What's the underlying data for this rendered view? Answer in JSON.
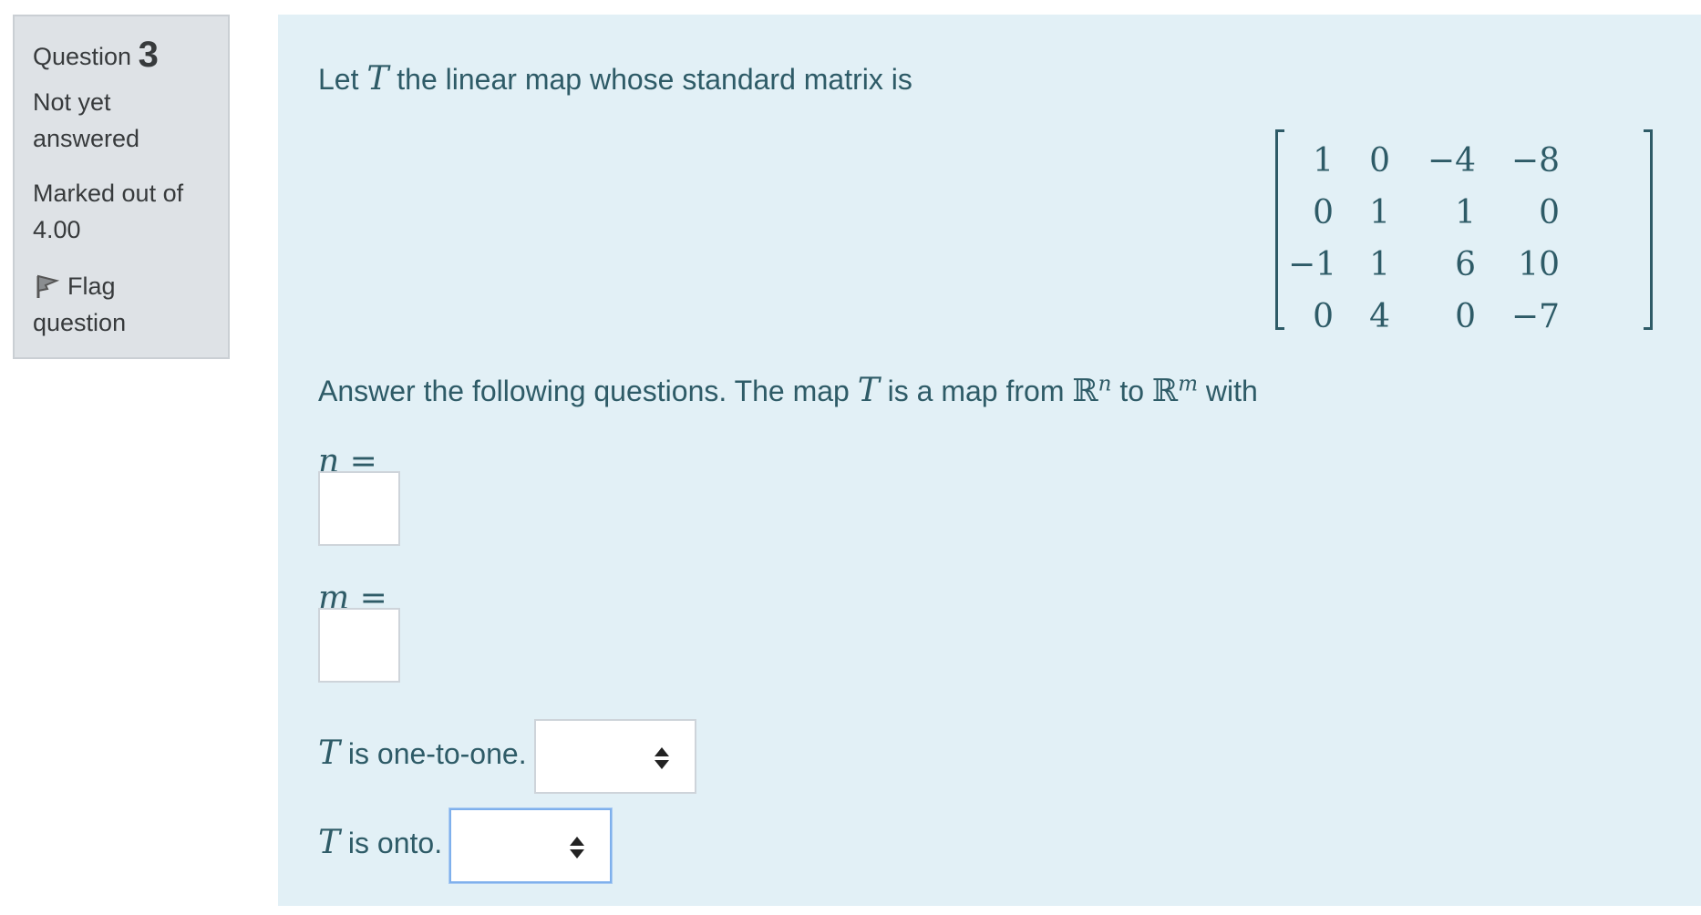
{
  "info": {
    "question_word": "Question",
    "question_number": "3",
    "state": "Not yet answered",
    "grade": "Marked out of 4.00",
    "flag_label": "Flag question"
  },
  "content": {
    "intro_prefix": "Let",
    "intro_var": "T",
    "intro_suffix": "the linear map whose standard matrix is",
    "matrix": [
      [
        "1",
        "0",
        "−4",
        "−8"
      ],
      [
        "0",
        "1",
        "1",
        "0"
      ],
      [
        "−1",
        "1",
        "6",
        "10"
      ],
      [
        "0",
        "4",
        "0",
        "−7"
      ]
    ],
    "question_text_1": "Answer the following questions. The map",
    "question_var": "T",
    "question_text_2": "is a map from",
    "domain_set": "ℝ",
    "domain_exp": "n",
    "question_text_3": "to",
    "codomain_set": "ℝ",
    "codomain_exp": "m",
    "question_text_4": "with",
    "n_label": "n =",
    "n_value": "",
    "m_label": "m =",
    "m_value": "",
    "one_to_one_var": "T",
    "one_to_one_label": "is one-to-one.",
    "one_to_one_selected": "",
    "onto_var": "T",
    "onto_label": "is onto.",
    "onto_selected": ""
  },
  "colors": {
    "content_background": "#e2f0f6",
    "info_background": "#dee2e6",
    "text": "#2e5b67",
    "focus_border": "#7fb0ec"
  },
  "icons": {
    "flag": "flag-icon",
    "select_arrows": "select-arrows-icon"
  }
}
